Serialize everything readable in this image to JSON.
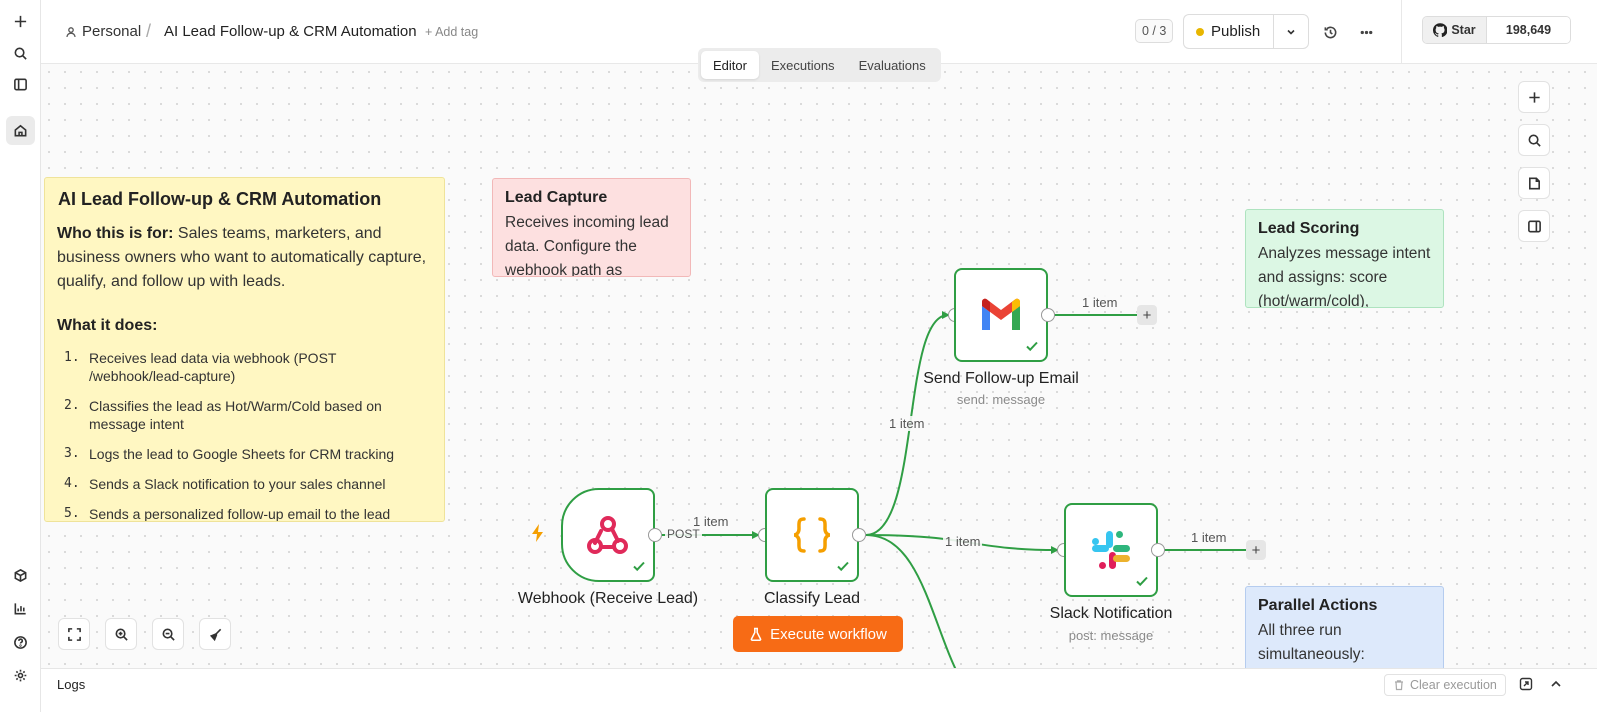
{
  "header": {
    "workspace": "Personal",
    "separator": "/",
    "title": "AI Lead Follow-up & CRM Automation",
    "add_tag": "+ Add tag",
    "counter": "0 / 3",
    "publish_label": "Publish",
    "github_star_label": "Star",
    "github_star_count": "198,649"
  },
  "tabs": [
    {
      "label": "Editor",
      "active": true
    },
    {
      "label": "Executions",
      "active": false
    },
    {
      "label": "Evaluations",
      "active": false
    }
  ],
  "notes": {
    "overview": {
      "title": "AI Lead Follow-up & CRM Automation",
      "who_label": "Who this is for:",
      "who_text": "Sales teams, marketers, and business owners who want to automatically capture, qualify, and follow up with leads.",
      "what_label": "What it does:",
      "steps": [
        {
          "num": "1.",
          "text": "Receives lead data via webhook (POST /webhook/lead-capture)"
        },
        {
          "num": "2.",
          "text": "Classifies the lead as Hot/Warm/Cold based on message intent"
        },
        {
          "num": "3.",
          "text": "Logs the lead to Google Sheets for CRM tracking"
        },
        {
          "num": "4.",
          "text": "Sends a Slack notification to your sales channel"
        },
        {
          "num": "5.",
          "text": "Sends a personalized follow-up email to the lead"
        }
      ]
    },
    "lead_capture": {
      "title": "Lead Capture",
      "text": "Receives incoming lead data. Configure the webhook path as"
    },
    "lead_scoring": {
      "title": "Lead Scoring",
      "text": "Analyzes message intent and assigns: score (hot/warm/cold),"
    },
    "parallel": {
      "title": "Parallel Actions",
      "text": "All three run simultaneously:"
    }
  },
  "nodes": {
    "webhook": {
      "label": "Webhook (Receive Lead)",
      "output_label": "POST"
    },
    "classify": {
      "label": "Classify Lead"
    },
    "email": {
      "label": "Send Follow-up Email",
      "subtitle": "send: message"
    },
    "slack": {
      "label": "Slack Notification",
      "subtitle": "post: message"
    }
  },
  "edges": {
    "webhook_to_classify": "1 item",
    "classify_to_email": "1 item",
    "classify_to_slack": "1 item",
    "email_out": "1 item",
    "slack_out": "1 item"
  },
  "execute_label": "Execute workflow",
  "logs": {
    "title": "Logs",
    "clear_label": "Clear execution"
  },
  "colors": {
    "success": "#2f9e44",
    "execute": "#f76b15",
    "note_yellow": "#fff7c2",
    "note_red": "#fde0e0",
    "note_green": "#dcf7e4",
    "note_blue": "#dde9fb"
  }
}
